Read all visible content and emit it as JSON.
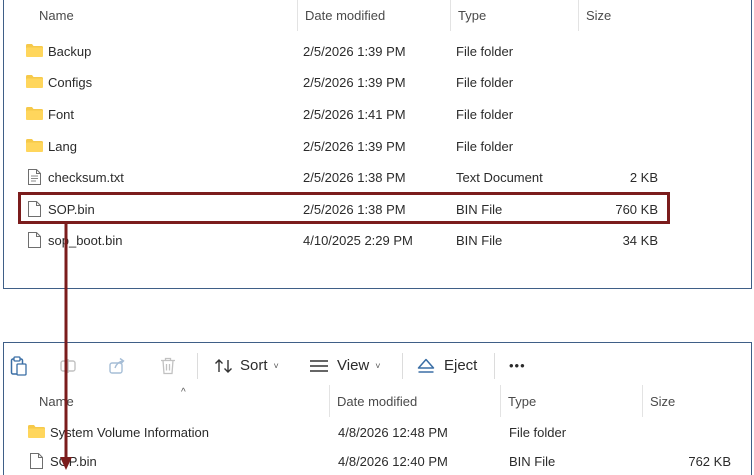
{
  "top_explorer": {
    "columns": {
      "name": "Name",
      "date": "Date modified",
      "type": "Type",
      "size": "Size"
    },
    "files": [
      {
        "name": "Backup",
        "date": "2/5/2026 1:39 PM",
        "type": "File folder",
        "size": "",
        "icon": "folder-icon"
      },
      {
        "name": "Configs",
        "date": "2/5/2026 1:39 PM",
        "type": "File folder",
        "size": "",
        "icon": "folder-icon"
      },
      {
        "name": "Font",
        "date": "2/5/2026 1:41 PM",
        "type": "File folder",
        "size": "",
        "icon": "folder-icon"
      },
      {
        "name": "Lang",
        "date": "2/5/2026 1:39 PM",
        "type": "File folder",
        "size": "",
        "icon": "folder-icon"
      },
      {
        "name": "checksum.txt",
        "date": "2/5/2026 1:38 PM",
        "type": "Text Document",
        "size": "2 KB",
        "icon": "text-file-icon"
      },
      {
        "name": "SOP.bin",
        "date": "2/5/2026 1:38 PM",
        "type": "BIN File",
        "size": "760 KB",
        "icon": "file-icon"
      },
      {
        "name": "sop_boot.bin",
        "date": "4/10/2025 2:29 PM",
        "type": "BIN File",
        "size": "34 KB",
        "icon": "file-icon"
      }
    ],
    "highlighted_file": "SOP.bin"
  },
  "bottom_explorer": {
    "toolbar": {
      "sort_label": "Sort",
      "view_label": "View",
      "eject_label": "Eject",
      "more_label": "•••",
      "icons": [
        "paste-icon",
        "rename-icon",
        "share-icon",
        "delete-icon",
        "sort-icon",
        "view-icon",
        "eject-icon"
      ]
    },
    "columns": {
      "name": "Name",
      "date": "Date modified",
      "type": "Type",
      "size": "Size"
    },
    "files": [
      {
        "name": "System Volume Information",
        "date": "4/8/2026 12:48 PM",
        "type": "File folder",
        "size": "",
        "icon": "folder-icon"
      },
      {
        "name": "SOP.bin",
        "date": "4/8/2026 12:40 PM",
        "type": "BIN File",
        "size": "762 KB",
        "icon": "file-icon"
      }
    ]
  },
  "colors": {
    "highlight": "#7b1c1c",
    "folder": "#f6c94a",
    "panel_border": "#3f5f87"
  }
}
